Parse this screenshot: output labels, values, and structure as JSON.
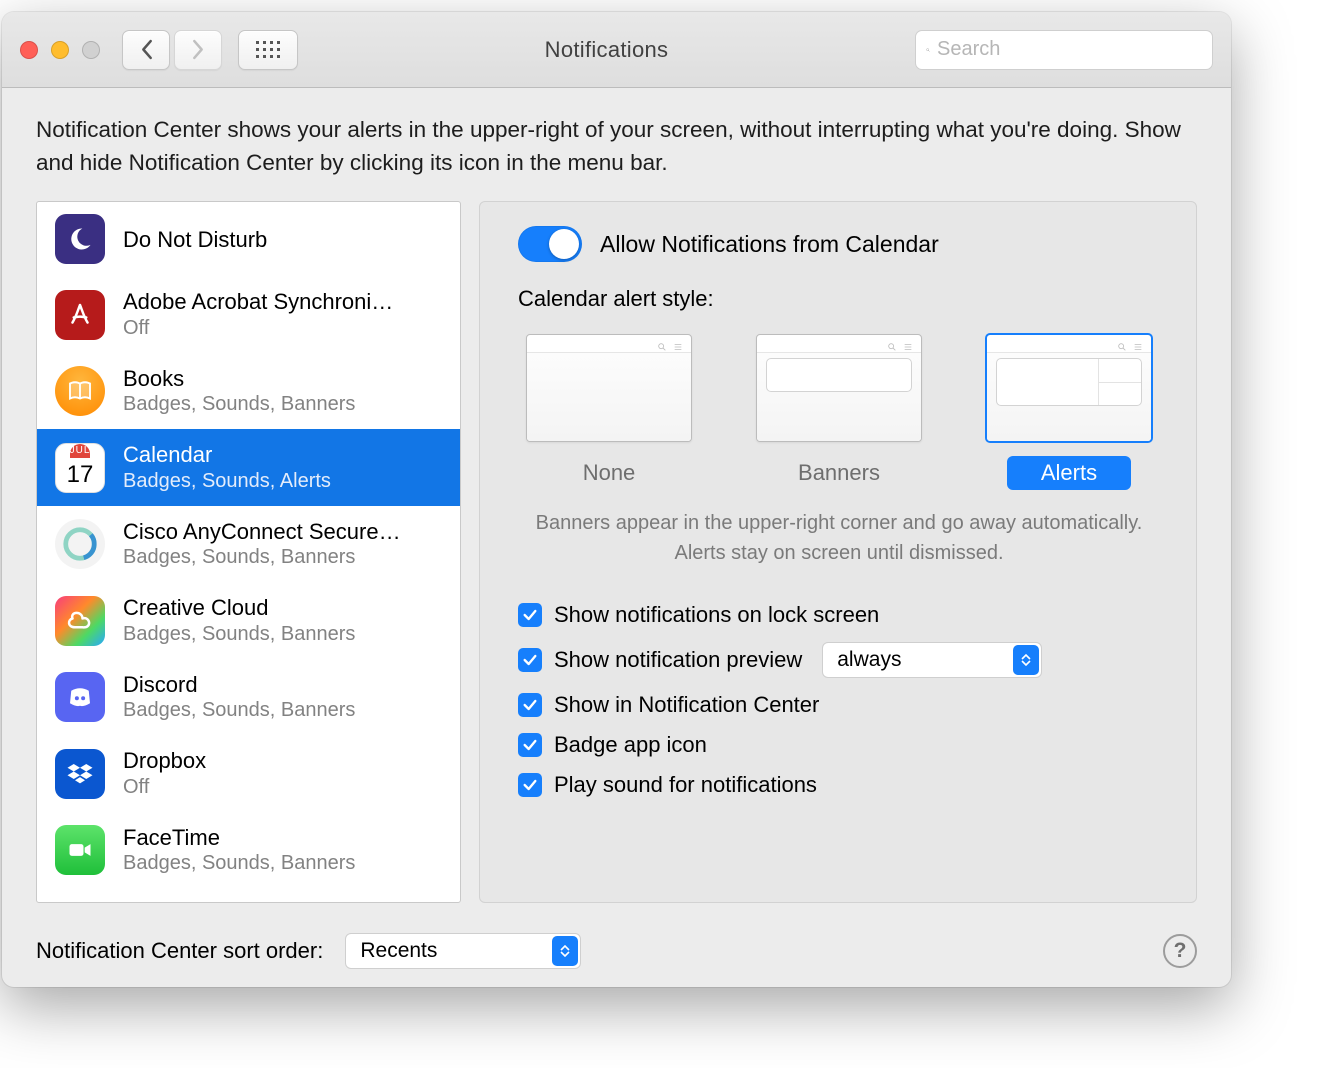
{
  "window": {
    "title": "Notifications",
    "search_placeholder": "Search"
  },
  "lead": "Notification Center shows your alerts in the upper-right of your screen, without interrupting what you're doing. Show and hide Notification Center by clicking its icon in the menu bar.",
  "apps": [
    {
      "name": "Do Not Disturb",
      "sub": "",
      "icon": "moon"
    },
    {
      "name": "Adobe Acrobat Synchroni…",
      "sub": "Off",
      "icon": "acrobat"
    },
    {
      "name": "Books",
      "sub": "Badges, Sounds, Banners",
      "icon": "books"
    },
    {
      "name": "Calendar",
      "sub": "Badges, Sounds, Alerts",
      "icon": "cal",
      "selected": true,
      "cal_month": "JUL",
      "cal_day": "17"
    },
    {
      "name": "Cisco AnyConnect Secure…",
      "sub": "Badges, Sounds, Banners",
      "icon": "cisco"
    },
    {
      "name": "Creative Cloud",
      "sub": "Badges, Sounds, Banners",
      "icon": "cc"
    },
    {
      "name": "Discord",
      "sub": "Badges, Sounds, Banners",
      "icon": "discord"
    },
    {
      "name": "Dropbox",
      "sub": "Off",
      "icon": "dropbox"
    },
    {
      "name": "FaceTime",
      "sub": "Badges, Sounds, Banners",
      "icon": "facetime"
    }
  ],
  "detail": {
    "allow_label": "Allow Notifications from Calendar",
    "section_label": "Calendar alert style:",
    "styles": {
      "none": "None",
      "banners": "Banners",
      "alerts": "Alerts"
    },
    "hint": "Banners appear in the upper-right corner and go away automatically. Alerts stay on screen until dismissed.",
    "options": {
      "lock": "Show notifications on lock screen",
      "preview": "Show notification preview",
      "preview_value": "always",
      "center": "Show in Notification Center",
      "badge": "Badge app icon",
      "sound": "Play sound for notifications"
    }
  },
  "footer": {
    "label": "Notification Center sort order:",
    "value": "Recents"
  }
}
